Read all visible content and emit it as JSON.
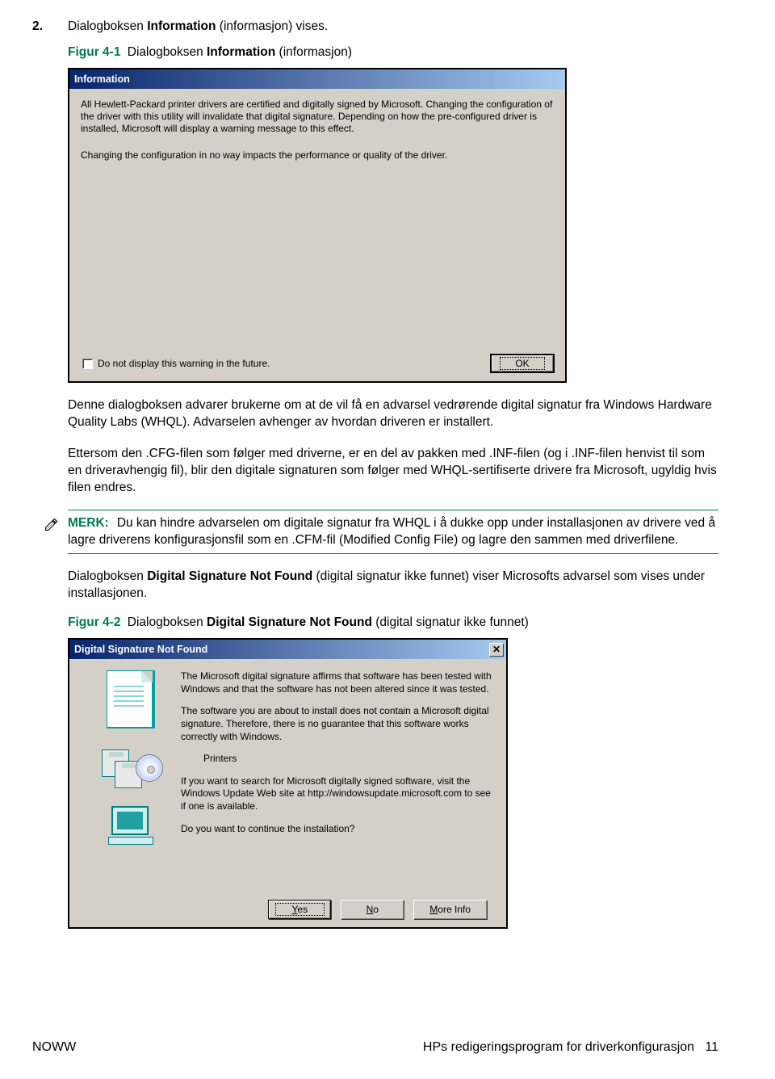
{
  "step": {
    "num": "2.",
    "text_pre": "Dialogboksen ",
    "bold": "Information",
    "text_post": " (informasjon) vises."
  },
  "fig1": {
    "num": "Figur 4-1",
    "pre": " Dialogboksen ",
    "bold": "Information",
    "post": " (informasjon)"
  },
  "dialog1": {
    "title": "Information",
    "p1": "All Hewlett-Packard printer drivers are certified and digitally signed by Microsoft. Changing the configuration of the driver with this utility will invalidate that digital signature.  Depending on how the pre-configured driver is installed, Microsoft will display a warning message to this effect.",
    "p2": "Changing the configuration in no way impacts the performance or quality of the driver.",
    "checkbox": "Do not display this warning in the future.",
    "ok": "OK"
  },
  "para1": {
    "pre": "Denne dialogboksen advarer brukerne om at de vil få en advarsel vedrørende digital signatur fra Windows Hardware Quality Labs (WHQL). Advarselen avhenger av hvordan driveren er installert."
  },
  "para2": "Ettersom den .CFG-filen som følger med driverne, er en del av pakken med .INF-filen (og i .INF-filen henvist til som en driveravhengig fil), blir den digitale signaturen som følger med WHQL-sertifiserte drivere fra Microsoft, ugyldig hvis filen endres.",
  "merk": {
    "label": "MERK:",
    "text": "Du kan hindre advarselen om digitale signatur fra WHQL i å dukke opp under installasjonen av drivere ved å lagre driverens konfigurasjonsfil som en .CFM-fil (Modified Config File) og lagre den sammen med driverfilene."
  },
  "para3": {
    "pre": "Dialogboksen ",
    "bold": "Digital Signature Not Found",
    "post": " (digital signatur ikke funnet) viser Microsofts advarsel som vises under installasjonen."
  },
  "fig2": {
    "num": "Figur 4-2",
    "pre": " Dialogboksen ",
    "bold": "Digital Signature Not Found",
    "post": " (digital signatur ikke funnet)"
  },
  "dialog2": {
    "title": "Digital Signature Not Found",
    "p1": "The Microsoft digital signature affirms that software has been tested with Windows and that the software has not been altered since it was tested.",
    "p2": "The software you are about to install does not contain a Microsoft digital signature. Therefore,  there is no guarantee that this software works correctly with Windows.",
    "device": "Printers",
    "p3": "If you want to search for Microsoft digitally signed software, visit the Windows Update Web site at http://windowsupdate.microsoft.com to see if one is available.",
    "p4": "Do you want to continue the installation?",
    "yes_u": "Y",
    "yes_r": "es",
    "no_u": "N",
    "no_r": "o",
    "more_u": "M",
    "more_r": "ore Info"
  },
  "footer": {
    "left": "NOWW",
    "right_text": "HPs redigeringsprogram for driverkonfigurasjon",
    "page": "11"
  }
}
